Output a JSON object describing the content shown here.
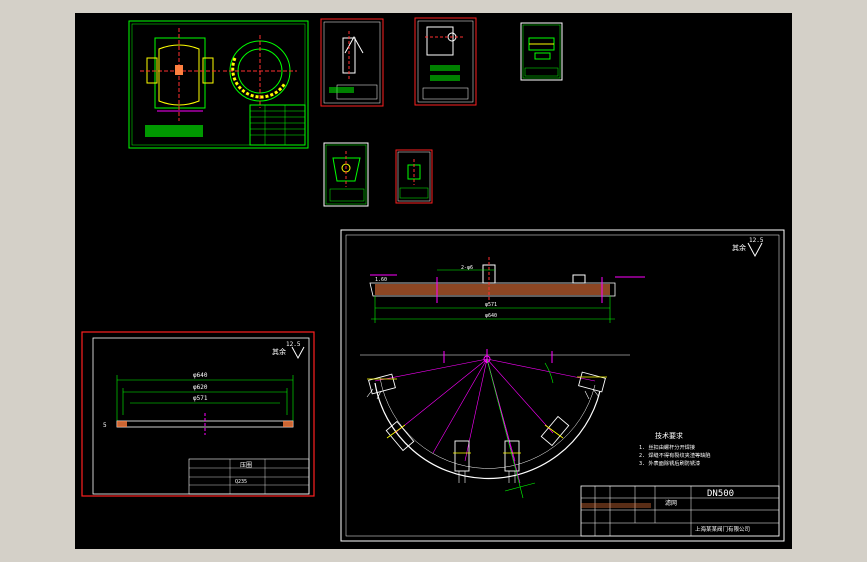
{
  "colors": {
    "background": "#000000",
    "frame": "#d4d0c8",
    "border_white": "#ffffff",
    "border_red": "#ff2020",
    "geometry_green": "#00ff00",
    "geometry_yellow": "#ffff00",
    "dimension_magenta": "#ff00ff",
    "centerline_red": "#ff3030",
    "text_white": "#ffffff",
    "hatch": "#ff8040"
  },
  "sheets": [
    {
      "name": "assembly-drawing-sheet"
    },
    {
      "name": "part-sheet-1"
    },
    {
      "name": "part-sheet-2"
    },
    {
      "name": "part-sheet-3"
    },
    {
      "name": "part-sheet-4"
    },
    {
      "name": "part-sheet-5"
    }
  ],
  "ring_sheet": {
    "roughness_label": "其余",
    "roughness_value": "12.5",
    "dims": [
      "φ640",
      "φ620",
      "φ571"
    ],
    "thickness": "5",
    "title_cell": "压圈",
    "material": "Q235"
  },
  "main_sheet": {
    "roughness_label": "其余",
    "roughness_value": "12.5",
    "top_dims": [
      "1.60",
      "2-φ6",
      "φ571",
      "φ640"
    ],
    "tech_title": "技术要求",
    "tech_notes": [
      "1. 丝扣由螺杆分开焊接",
      "2. 焊缝不得有裂纹夹渣等缺陷",
      "3. 外表面除锈后刷防锈漆"
    ],
    "title_block": {
      "drawing_no": "DN500",
      "part_name": "滤网",
      "company": "上海某某阀门有限公司"
    }
  }
}
